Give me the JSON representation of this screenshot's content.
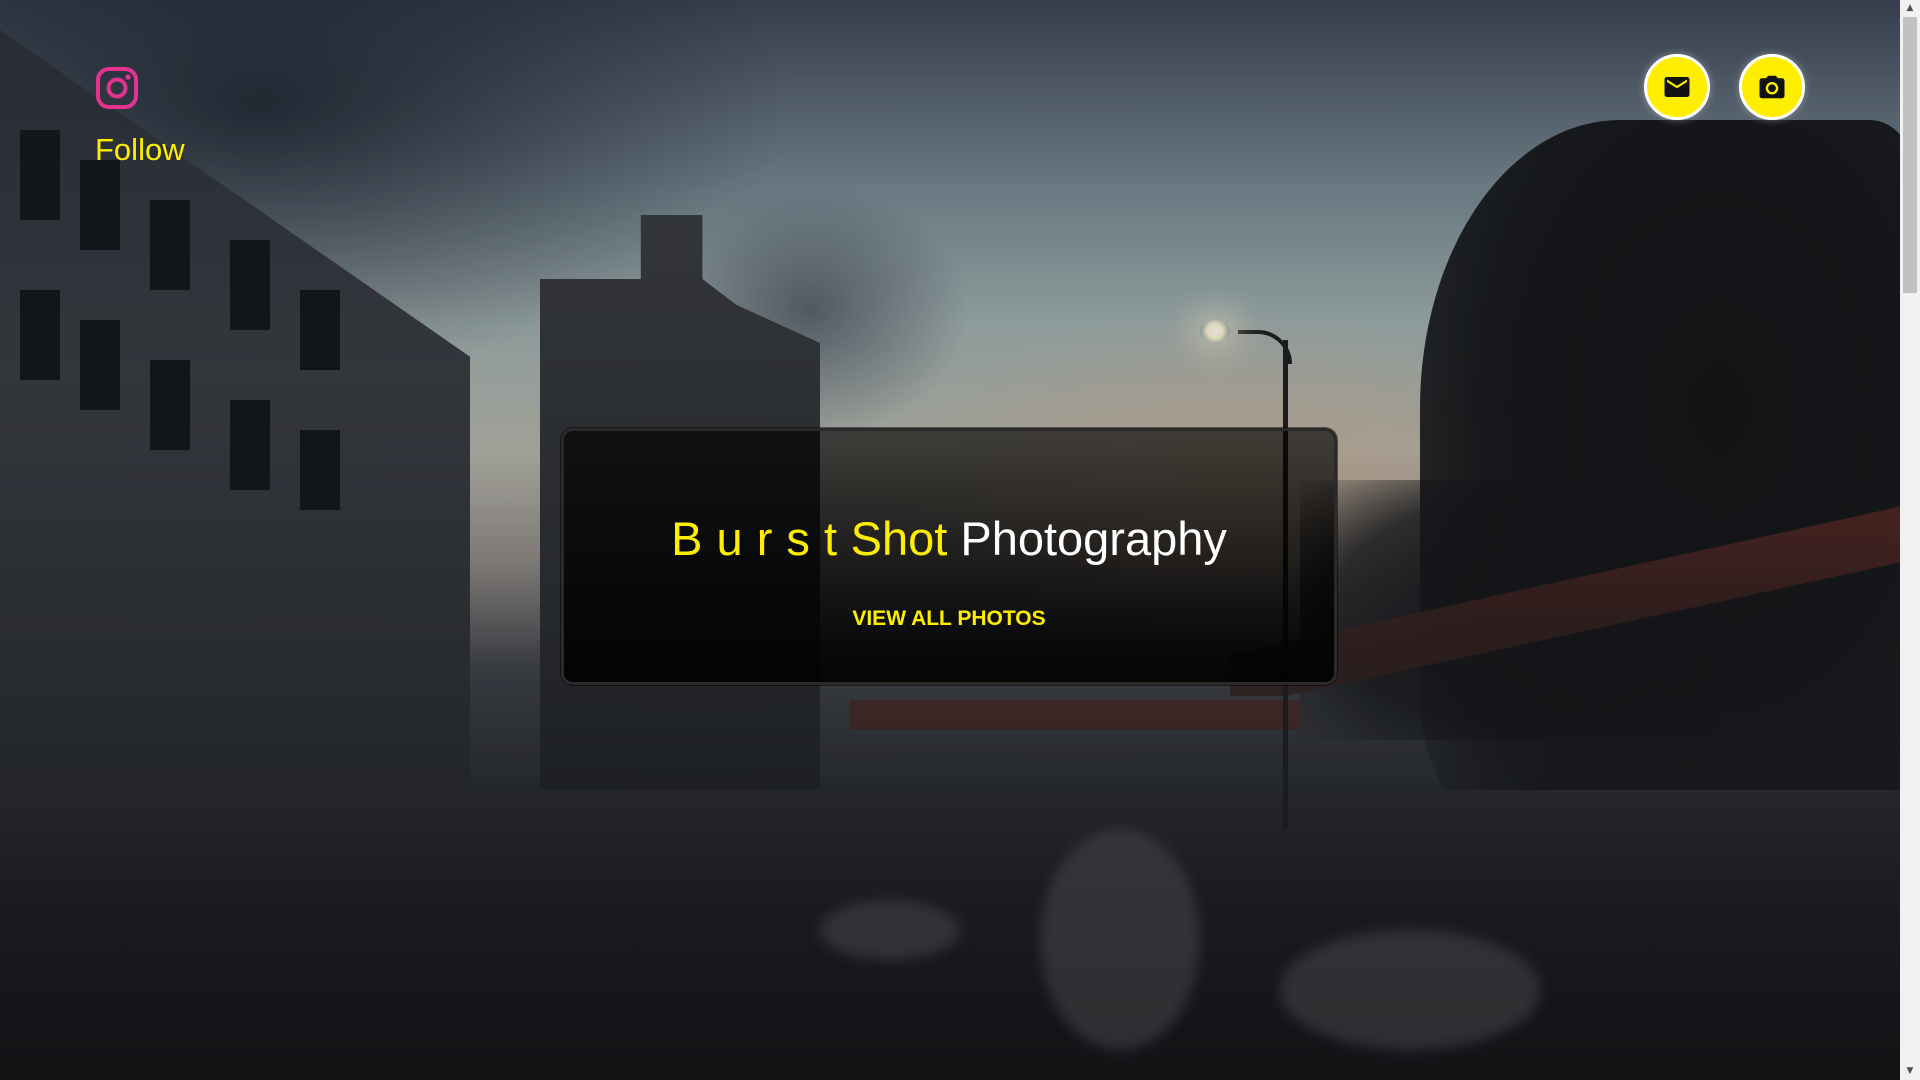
{
  "page": {
    "accent_color": "#ffee00",
    "instagram_color": "#e4328f"
  },
  "follow": {
    "icon": "instagram-icon",
    "label": "Follow"
  },
  "header_buttons": {
    "mail": {
      "icon": "mail-icon"
    },
    "camera": {
      "icon": "camera-icon"
    }
  },
  "hero": {
    "title_part1": "B u r s t",
    "title_part2": "Shot",
    "title_part3": "Photography",
    "cta_label": "VIEW ALL PHOTOS"
  },
  "scrollbar": {
    "up_arrow": "▲",
    "down_arrow": "▼"
  }
}
